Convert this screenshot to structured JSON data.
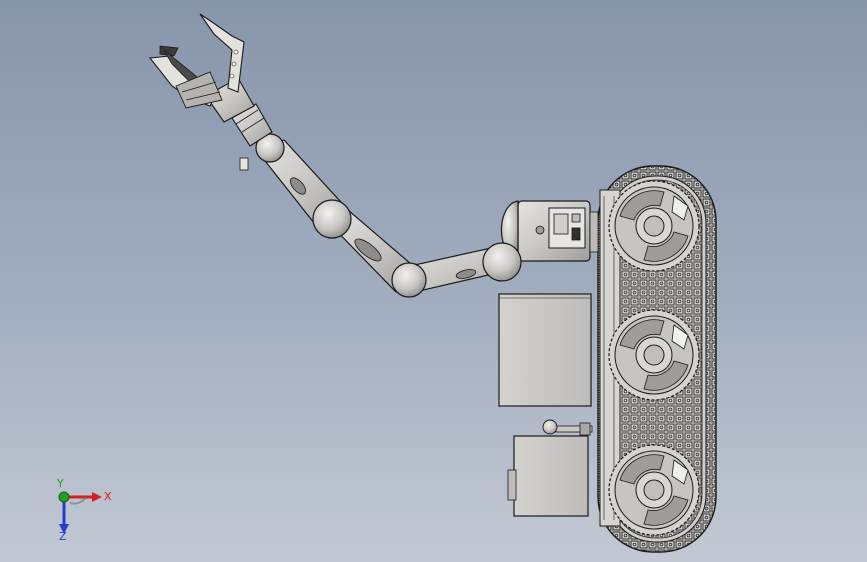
{
  "viewport": {
    "background_top": "#8795ab",
    "background_bottom": "#c3c9d4"
  },
  "model": {
    "part_fill": "#c9c8c4",
    "part_shade": "#9e9d99",
    "edge_color": "#1a1a1a"
  },
  "triad": {
    "x_label": "X",
    "y_label": "Y",
    "z_label": "Z",
    "x_color": "#d42020",
    "y_color": "#22a022",
    "z_color": "#2a3ccc"
  }
}
